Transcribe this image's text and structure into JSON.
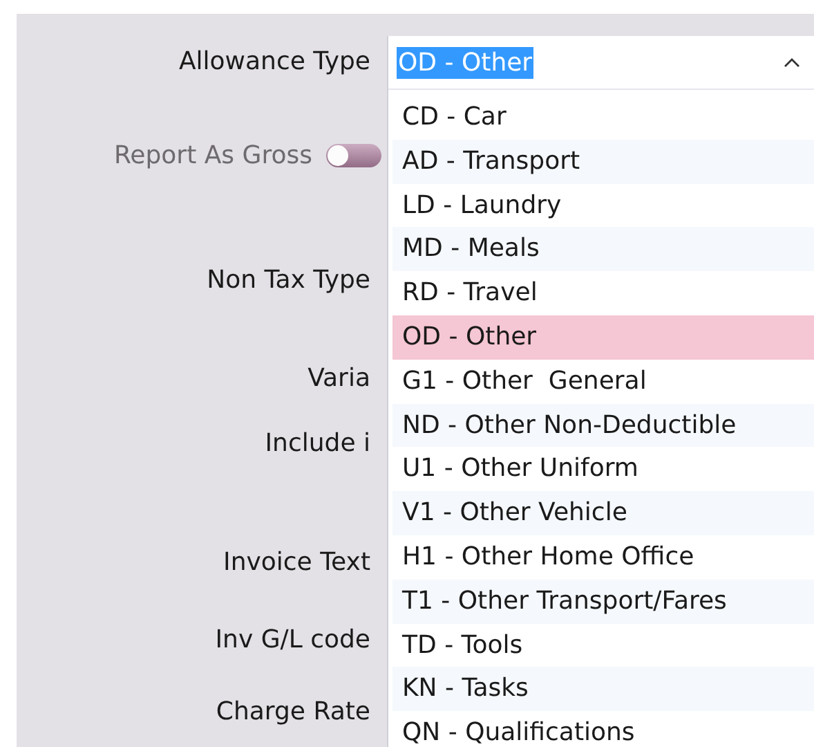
{
  "form": {
    "fields": [
      {
        "kind": "label",
        "label": "Allowance Type"
      },
      {
        "kind": "toggle",
        "label": "Report As Gross",
        "on": false,
        "disabled": true
      },
      {
        "kind": "label",
        "label": "Non Tax Type"
      },
      {
        "kind": "label",
        "label": "Varia"
      },
      {
        "kind": "label",
        "label": "Include i"
      },
      {
        "kind": "label",
        "label": "Invoice Text"
      },
      {
        "kind": "label",
        "label": "Inv G/L code"
      },
      {
        "kind": "label",
        "label": "Charge Rate"
      }
    ]
  },
  "dropdown": {
    "value": "OD - Other",
    "expanded": true,
    "options": [
      {
        "label": "CD - Car",
        "selected": false
      },
      {
        "label": "AD - Transport",
        "selected": false
      },
      {
        "label": "LD - Laundry",
        "selected": false
      },
      {
        "label": "MD - Meals",
        "selected": false
      },
      {
        "label": "RD - Travel",
        "selected": false
      },
      {
        "label": "OD - Other",
        "selected": true
      },
      {
        "label": "G1 - Other  General",
        "selected": false
      },
      {
        "label": "ND - Other Non-Deductible",
        "selected": false
      },
      {
        "label": "U1 - Other Uniform",
        "selected": false
      },
      {
        "label": "V1 - Other Vehicle",
        "selected": false
      },
      {
        "label": "H1 - Other Home Office",
        "selected": false
      },
      {
        "label": "T1 - Other Transport/Fares",
        "selected": false
      },
      {
        "label": "TD - Tools",
        "selected": false
      },
      {
        "label": "KN - Tasks",
        "selected": false
      },
      {
        "label": "QN - Qualifications",
        "selected": false
      }
    ]
  }
}
